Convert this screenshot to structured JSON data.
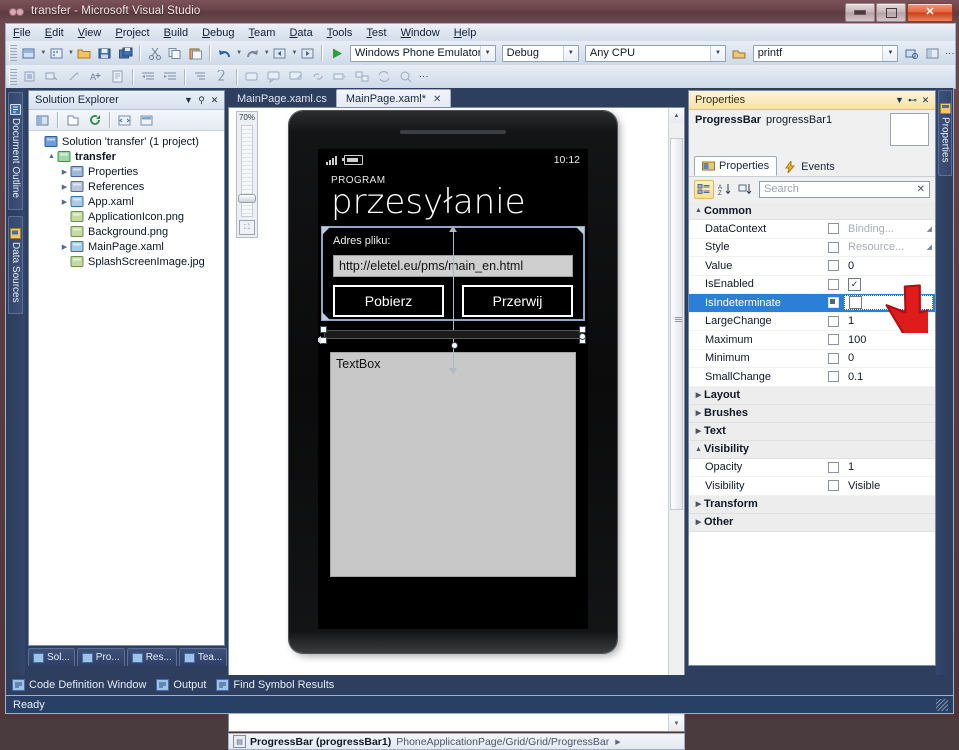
{
  "window": {
    "title": "transfer - Microsoft Visual Studio",
    "icon": "visual-studio-icon",
    "controls": {
      "minimize": "–",
      "maximize": "□",
      "close": "✕"
    }
  },
  "menu": {
    "items": [
      {
        "label": "File"
      },
      {
        "label": "Edit"
      },
      {
        "label": "View"
      },
      {
        "label": "Project"
      },
      {
        "label": "Build"
      },
      {
        "label": "Debug"
      },
      {
        "label": "Team"
      },
      {
        "label": "Data"
      },
      {
        "label": "Tools"
      },
      {
        "label": "Test"
      },
      {
        "label": "Window"
      },
      {
        "label": "Help"
      }
    ]
  },
  "toolbar": {
    "run_glyph": "▶",
    "target_device": "Windows Phone Emulator",
    "configuration": "Debug",
    "platform": "Any CPU",
    "find_text": "printf",
    "overflow_glyph": "⋮"
  },
  "left_dock": {
    "tabs": [
      {
        "label": "Document Outline",
        "icon": "document-outline-icon"
      },
      {
        "label": "Data Sources",
        "icon": "data-sources-icon"
      }
    ]
  },
  "solution_explorer": {
    "title": "Solution Explorer",
    "tree": [
      {
        "label": "Solution 'transfer' (1 project)",
        "indent": 0,
        "twisty": "",
        "icon": "solution-icon",
        "bold": false
      },
      {
        "label": "transfer",
        "indent": 1,
        "twisty": "▲",
        "icon": "project-csharp-icon",
        "bold": true
      },
      {
        "label": "Properties",
        "indent": 2,
        "twisty": "▶",
        "icon": "properties-folder-icon",
        "bold": false
      },
      {
        "label": "References",
        "indent": 2,
        "twisty": "▶",
        "icon": "references-folder-icon",
        "bold": false
      },
      {
        "label": "App.xaml",
        "indent": 2,
        "twisty": "▶",
        "icon": "xaml-file-icon",
        "bold": false
      },
      {
        "label": "ApplicationIcon.png",
        "indent": 2,
        "twisty": "",
        "icon": "image-file-icon",
        "bold": false
      },
      {
        "label": "Background.png",
        "indent": 2,
        "twisty": "",
        "icon": "image-file-icon",
        "bold": false
      },
      {
        "label": "MainPage.xaml",
        "indent": 2,
        "twisty": "▶",
        "icon": "xaml-file-icon",
        "bold": false
      },
      {
        "label": "SplashScreenImage.jpg",
        "indent": 2,
        "twisty": "",
        "icon": "image-file-icon",
        "bold": false
      }
    ],
    "bottom_tabs": [
      {
        "label": "Sol...",
        "icon": "solution-explorer-icon"
      },
      {
        "label": "Pro...",
        "icon": "properties-icon"
      },
      {
        "label": "Res...",
        "icon": "resource-view-icon"
      },
      {
        "label": "Tea...",
        "icon": "team-explorer-icon"
      }
    ]
  },
  "document_tabs": [
    {
      "label": "MainPage.xaml.cs",
      "active": false,
      "dirty": false
    },
    {
      "label": "MainPage.xaml*",
      "active": true,
      "dirty": true,
      "close": "✕"
    }
  ],
  "designer": {
    "zoom_level": "70%",
    "fit_icon": "fit-to-window-icon",
    "phone": {
      "status_time": "10:12",
      "signal_icon": "signal-bars-icon",
      "battery_icon": "battery-icon",
      "app_title": "PROGRAM",
      "page_title": "przesyłanie",
      "address_label": "Adres pliku:",
      "address_value": "http://eletel.eu/pms/main_en.html",
      "button_download": "Pobierz",
      "button_cancel": "Przerwij",
      "textbox_text": "TextBox"
    }
  },
  "breadcrumb": {
    "icon": "element-icon",
    "element": "ProgressBar (progressBar1)",
    "path": "PhoneApplicationPage/Grid/Grid/ProgressBar",
    "more": "▶"
  },
  "properties_panel": {
    "title": "Properties",
    "object_type": "ProgressBar",
    "object_name": "progressBar1",
    "tabs": [
      {
        "label": "Properties",
        "icon": "properties-tab-icon",
        "active": true
      },
      {
        "label": "Events",
        "icon": "events-lightning-icon",
        "active": false
      }
    ],
    "sort_buttons": [
      {
        "icon": "category-sort-icon",
        "active": true
      },
      {
        "icon": "alphabetical-sort-icon",
        "active": false
      },
      {
        "icon": "property-source-icon",
        "active": false
      }
    ],
    "search_placeholder": "Search",
    "search_value": "",
    "clear_glyph": "✕",
    "categories": [
      {
        "name": "Common",
        "expanded": true,
        "twisty": "▲",
        "rows": [
          {
            "name": "DataContext",
            "marker": "square",
            "value": "Binding...",
            "dim": true,
            "expand": "◢",
            "selected": false
          },
          {
            "name": "Style",
            "marker": "square",
            "value": "Resource...",
            "dim": true,
            "expand": "◢",
            "selected": false
          },
          {
            "name": "Value",
            "marker": "square",
            "value": "0",
            "dim": false,
            "expand": "",
            "selected": false
          },
          {
            "name": "IsEnabled",
            "marker": "square",
            "value": "checkbox-checked",
            "dim": false,
            "expand": "",
            "selected": false
          },
          {
            "name": "IsIndeterminate",
            "marker": "square-filled",
            "value": "checkbox-unchecked",
            "dim": false,
            "expand": "",
            "selected": true
          },
          {
            "name": "LargeChange",
            "marker": "square",
            "value": "1",
            "dim": false,
            "expand": "",
            "selected": false
          },
          {
            "name": "Maximum",
            "marker": "square",
            "value": "100",
            "dim": false,
            "expand": "",
            "selected": false
          },
          {
            "name": "Minimum",
            "marker": "square",
            "value": "0",
            "dim": false,
            "expand": "",
            "selected": false
          },
          {
            "name": "SmallChange",
            "marker": "square",
            "value": "0.1",
            "dim": false,
            "expand": "",
            "selected": false
          }
        ]
      },
      {
        "name": "Layout",
        "expanded": false,
        "twisty": "▶",
        "rows": []
      },
      {
        "name": "Brushes",
        "expanded": false,
        "twisty": "▶",
        "rows": []
      },
      {
        "name": "Text",
        "expanded": false,
        "twisty": "▶",
        "rows": []
      },
      {
        "name": "Visibility",
        "expanded": true,
        "twisty": "▲",
        "rows": [
          {
            "name": "Opacity",
            "marker": "square",
            "value": "1",
            "dim": false,
            "expand": "",
            "selected": false
          },
          {
            "name": "Visibility",
            "marker": "square",
            "value": "Visible",
            "dim": false,
            "expand": "",
            "selected": false
          }
        ]
      },
      {
        "name": "Transform",
        "expanded": false,
        "twisty": "▶",
        "rows": []
      },
      {
        "name": "Other",
        "expanded": false,
        "twisty": "▶",
        "rows": []
      }
    ]
  },
  "right_dock": {
    "tabs": [
      {
        "label": "Properties",
        "icon": "properties-icon"
      }
    ]
  },
  "bottom_tool_tabs": [
    {
      "label": "Code Definition Window",
      "icon": "code-definition-icon"
    },
    {
      "label": "Output",
      "icon": "output-icon"
    },
    {
      "label": "Find Symbol Results",
      "icon": "find-symbol-icon"
    }
  ],
  "status_bar": {
    "text": "Ready"
  },
  "colors": {
    "selection_blue": "#2c7fd6",
    "cursor_red": "#e01b1b",
    "titlebar": "#6a4449",
    "dock_blue": "#2d3e5e",
    "props_header_gold": "#f6e2a8"
  }
}
